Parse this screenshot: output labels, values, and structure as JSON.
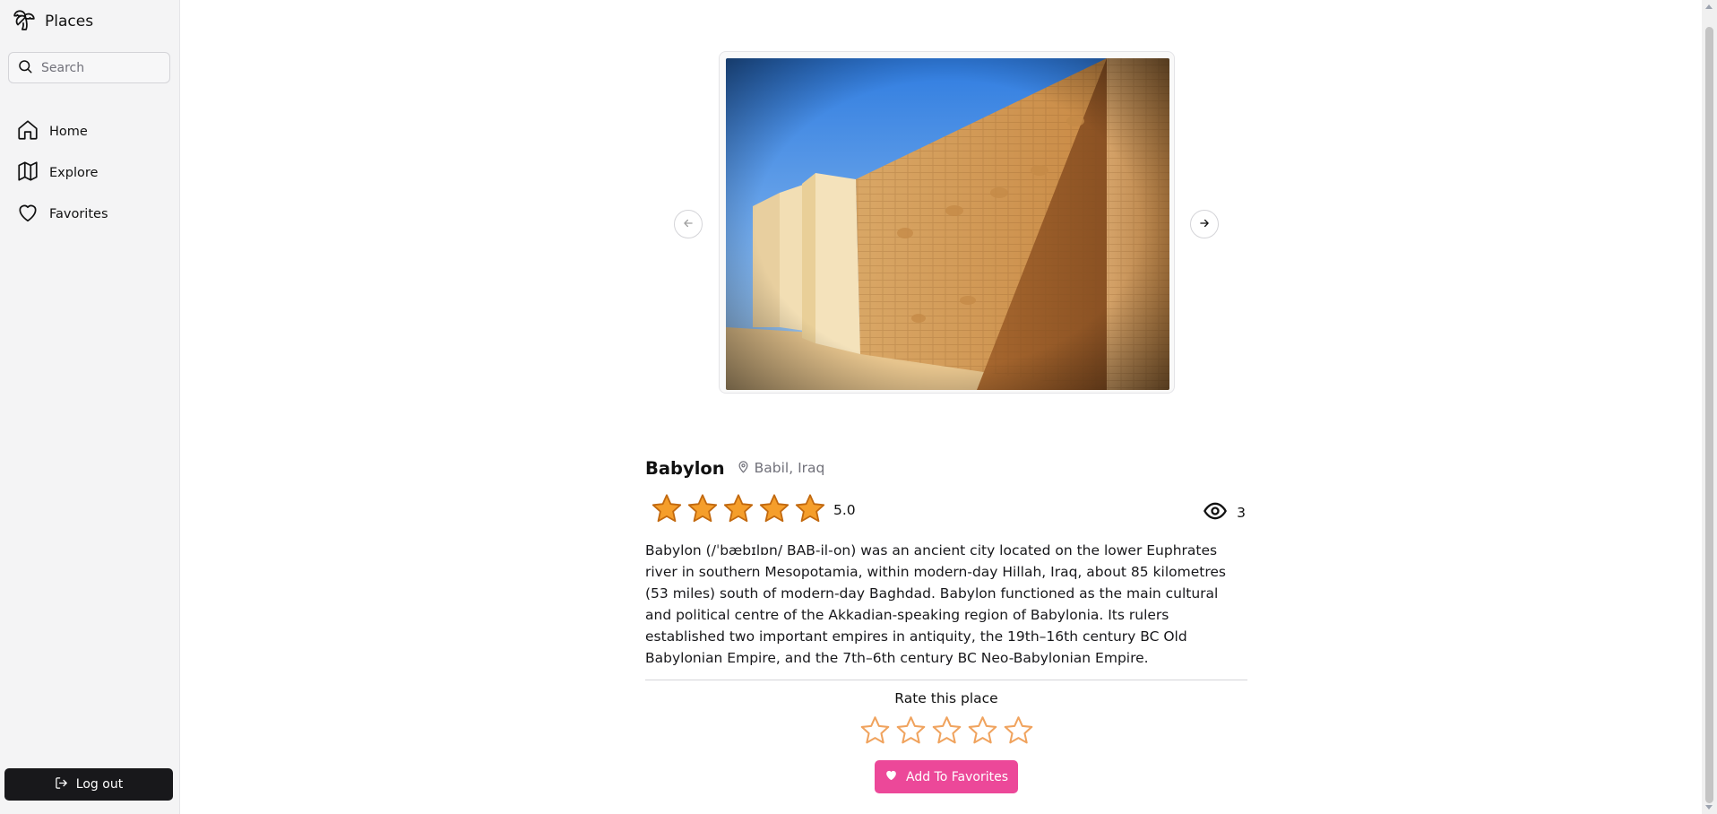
{
  "sidebar": {
    "brand": {
      "icon": "palm-tree-icon",
      "name": "Places"
    },
    "search": {
      "placeholder": "Search",
      "value": "",
      "icon": "search-icon"
    },
    "items": [
      {
        "label": "Home",
        "icon": "home-icon"
      },
      {
        "label": "Explore",
        "icon": "map-icon"
      },
      {
        "label": "Favorites",
        "icon": "heart-icon"
      }
    ],
    "logout": {
      "label": "Log out",
      "icon": "logout-icon"
    }
  },
  "carousel": {
    "prev_icon": "arrow-left-icon",
    "next_icon": "arrow-right-icon"
  },
  "place": {
    "name": "Babylon",
    "location": "Babil, Iraq",
    "rating": 5,
    "rating_text": "5.0",
    "views": "3",
    "description": "Babylon (/ˈbæbɪlɒn/ BAB-il-on) was an ancient city located on the lower Euphrates river in southern Mesopotamia, within modern-day Hillah, Iraq, about 85 kilometres (53 miles) south of modern-day Baghdad. Babylon functioned as the main cultural and political centre of the Akkadian-speaking region of Babylonia. Its rulers established two important empires in antiquity, the 19th–16th century BC Old Babylonian Empire, and the 7th–6th century BC Neo-Babylonian Empire."
  },
  "rate": {
    "title": "Rate this place",
    "current": 0,
    "max": 5
  },
  "favorite_button": {
    "label": "Add To Favorites",
    "icon": "heart-icon"
  },
  "colors": {
    "star_fill": "#f59e2b",
    "star_stroke": "#c2690f",
    "star_empty_stroke": "#f0a35e",
    "favorite": "#ec4899",
    "logout_bg": "#18181b"
  }
}
